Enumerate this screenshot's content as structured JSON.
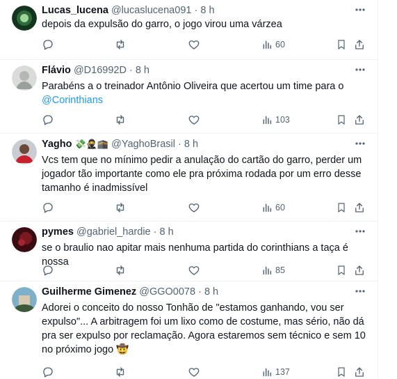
{
  "tweets": [
    {
      "name": "Lucas_lucena",
      "handle": "@lucaslucena091",
      "separator": "·",
      "time": "8 h",
      "text": "depois da expulsão do garro, o jogo virou uma várzea",
      "views": "60"
    },
    {
      "name": "Flávio",
      "handle": "@D16992D",
      "separator": "·",
      "time": "8 h",
      "text_before_mention": "Parabéns a o treinador Antônio Oliveira que acertou um time para o",
      "mention": "@Corinthians",
      "views": "103"
    },
    {
      "name": "Yagho",
      "name_emojis": "💸🥷🕋",
      "handle": "@YaghoBrasil",
      "separator": "·",
      "time": "8 h",
      "text": "Vcs tem que no mínimo pedir a anulação do cartão do garro, perder um jogador tão importante como ele pra próxima rodada por um erro desse tamanho é inadmissível",
      "views": "60"
    },
    {
      "name": "pymes",
      "handle": "@gabriel_hardie",
      "separator": "·",
      "time": "8 h",
      "text": "se o braulio nao apitar mais nenhuma partida do corinthians a taça é nossa",
      "views": "85"
    },
    {
      "name": "Guilherme Gimenez",
      "handle": "@GGO0078",
      "separator": "·",
      "time": "8 h",
      "text": "Adorei o conceito do nosso Tonhão de \"estamos ganhando, vou ser expulso\"... A arbitragem foi um lixo como de costume, mas sério, não dá pra ser expulso por reclamação. Agora estaremos sem técnico e sem 10 no próximo jogo 🤠",
      "views": "137"
    }
  ],
  "icons": {
    "more": "more-horizontal-icon",
    "reply": "reply-icon",
    "retweet": "retweet-icon",
    "like": "heart-icon",
    "views": "views-chart-icon",
    "bookmark": "bookmark-icon",
    "share": "share-icon"
  },
  "colors": {
    "text": "#0f1419",
    "secondary": "#536471",
    "link": "#1d9bf0",
    "divider": "#eff3f4"
  }
}
